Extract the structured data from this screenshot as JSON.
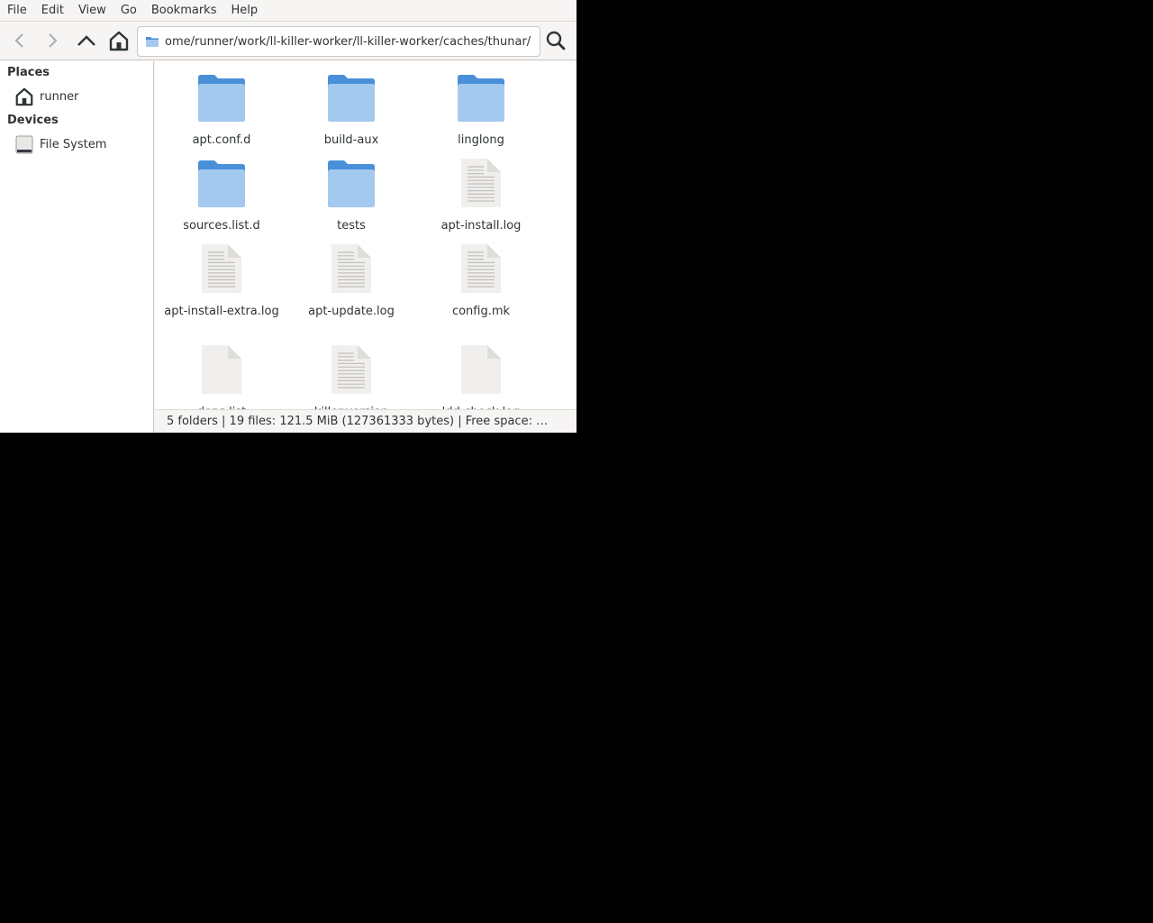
{
  "menubar": {
    "items": [
      "File",
      "Edit",
      "View",
      "Go",
      "Bookmarks",
      "Help"
    ]
  },
  "toolbar": {
    "back_icon": "go-back-icon",
    "forward_icon": "go-forward-icon",
    "up_icon": "go-up-icon",
    "home_icon": "home-icon",
    "location_path": "ome/runner/work/ll-killer-worker/ll-killer-worker/caches/thunar/",
    "search_icon": "search-icon"
  },
  "sidebar": {
    "places_header": "Places",
    "places": [
      {
        "label": "runner",
        "icon": "home-icon"
      }
    ],
    "devices_header": "Devices",
    "devices": [
      {
        "label": "File System",
        "icon": "drive-icon"
      }
    ]
  },
  "files": [
    {
      "name": "apt.conf.d",
      "type": "folder"
    },
    {
      "name": "build-aux",
      "type": "folder"
    },
    {
      "name": "linglong",
      "type": "folder"
    },
    {
      "name": "sources.list.d",
      "type": "folder"
    },
    {
      "name": "tests",
      "type": "folder"
    },
    {
      "name": "apt-install.log",
      "type": "text"
    },
    {
      "name": "apt-install-extra.log",
      "type": "text"
    },
    {
      "name": "apt-update.log",
      "type": "text"
    },
    {
      "name": "config.mk",
      "type": "text"
    },
    {
      "name": "deps.list",
      "type": "blank"
    },
    {
      "name": "killer.version",
      "type": "text"
    },
    {
      "name": "ldd-check.log",
      "type": "blank"
    }
  ],
  "statusbar": {
    "text": "5 folders  |  19 files: 121.5 MiB (127361333 bytes)  |  Free space: …"
  },
  "colors": {
    "folder_body": "#a4c9ef",
    "folder_tab": "#4a90d9",
    "doc_page": "#f0efee"
  }
}
